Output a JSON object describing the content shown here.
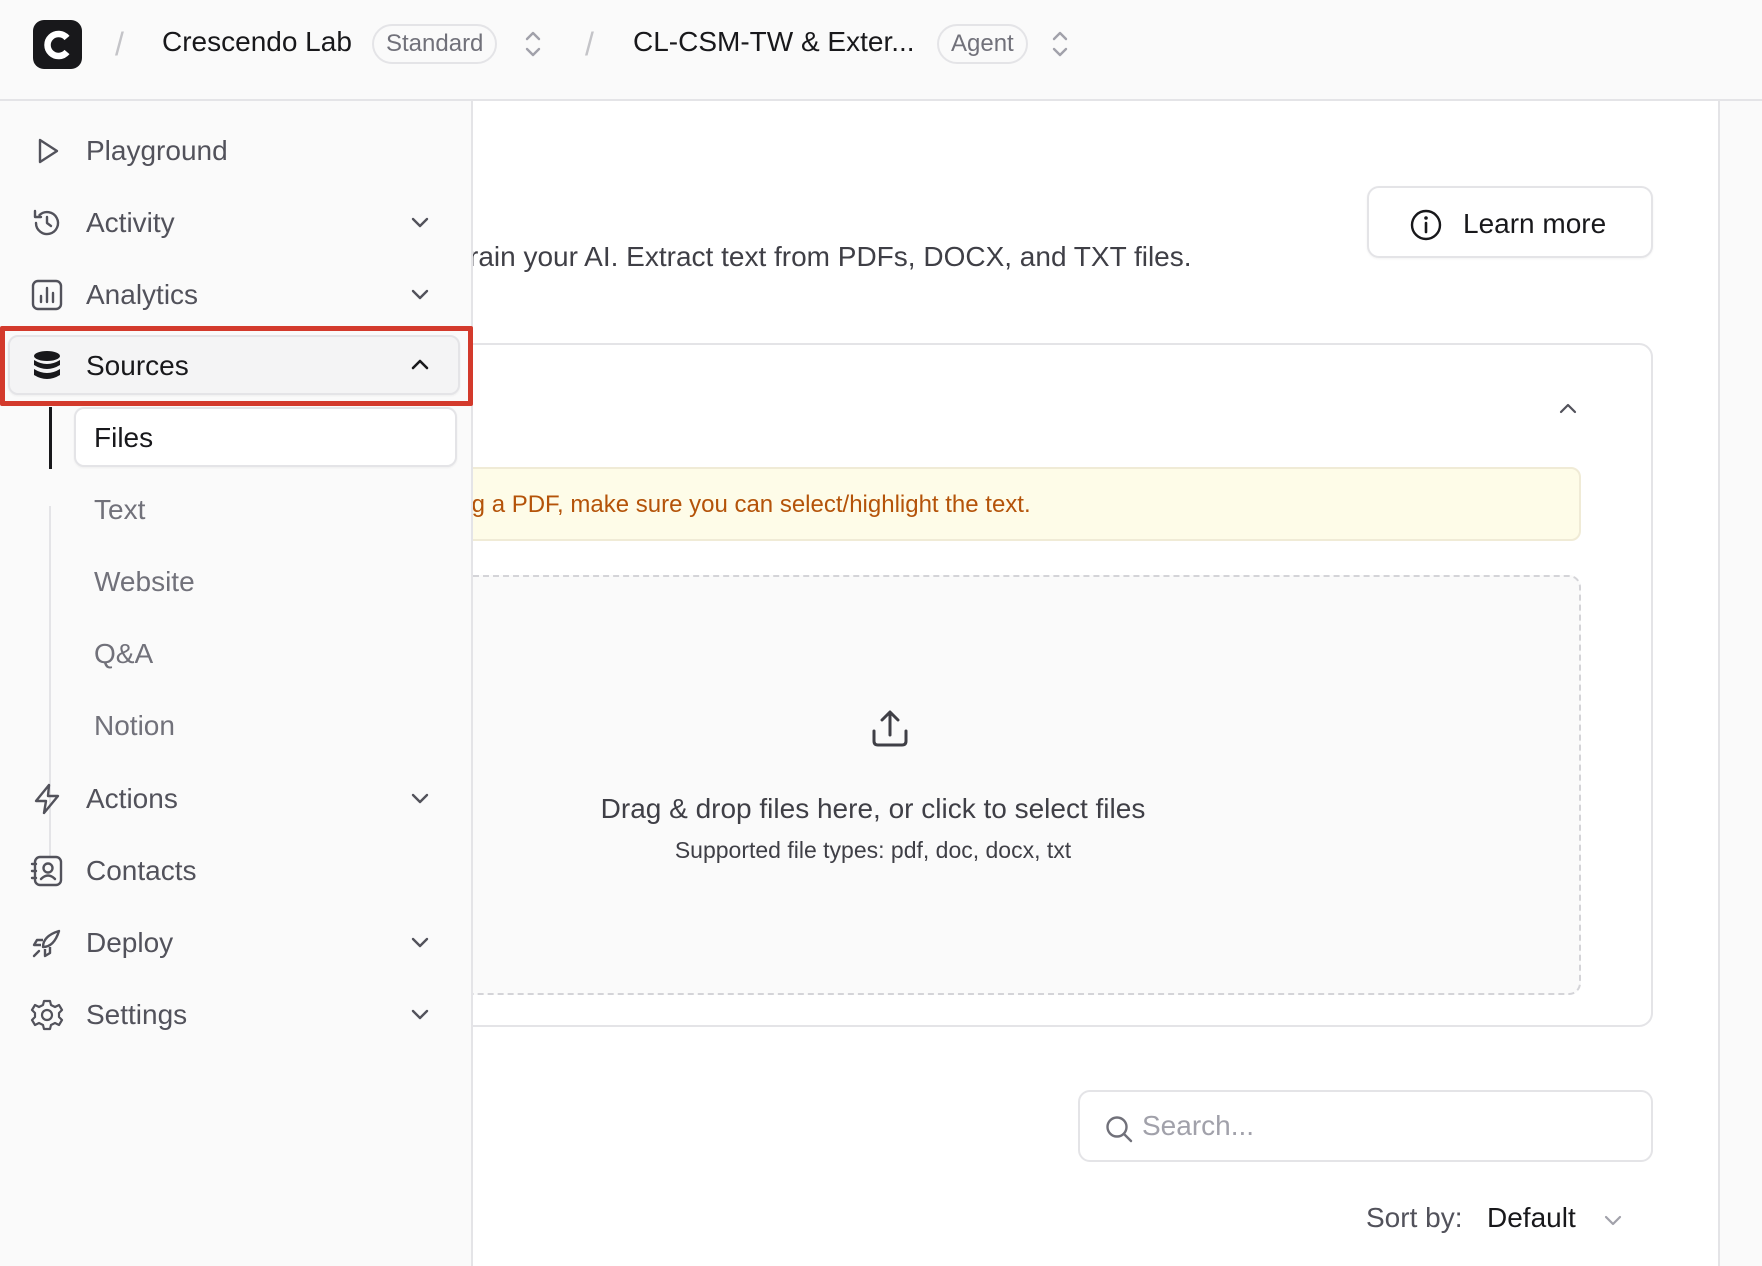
{
  "topbar": {
    "logo_letter": "C",
    "workspace_name": "Crescendo Lab",
    "workspace_plan": "Standard",
    "agent_name": "CL-CSM-TW & Exter...",
    "agent_badge": "Agent",
    "separator": "/"
  },
  "sidebar": {
    "items": [
      {
        "label": "Playground",
        "icon": "play-icon"
      },
      {
        "label": "Activity",
        "icon": "history-icon"
      },
      {
        "label": "Analytics",
        "icon": "chart-icon"
      },
      {
        "label": "Sources",
        "icon": "database-icon",
        "expanded": true
      },
      {
        "label": "Actions",
        "icon": "bolt-icon"
      },
      {
        "label": "Contacts",
        "icon": "contact-icon"
      },
      {
        "label": "Deploy",
        "icon": "rocket-icon"
      },
      {
        "label": "Settings",
        "icon": "gear-icon"
      }
    ],
    "sources_sub": [
      "Files",
      "Text",
      "Website",
      "Q&A",
      "Notion"
    ],
    "active_sub": "Files",
    "highlight_color": "#d33a2c"
  },
  "main": {
    "description": "rain your AI. Extract text from PDFs, DOCX, and TXT files.",
    "learn_more": "Learn more",
    "notice": "ing a PDF, make sure you can select/highlight the text.",
    "dropzone_title": "Drag & drop files here, or click to select files",
    "dropzone_subtitle": "Supported file types: pdf, doc, docx, txt",
    "search_placeholder": "Search...",
    "sort_label": "Sort by:",
    "sort_value": "Default"
  }
}
